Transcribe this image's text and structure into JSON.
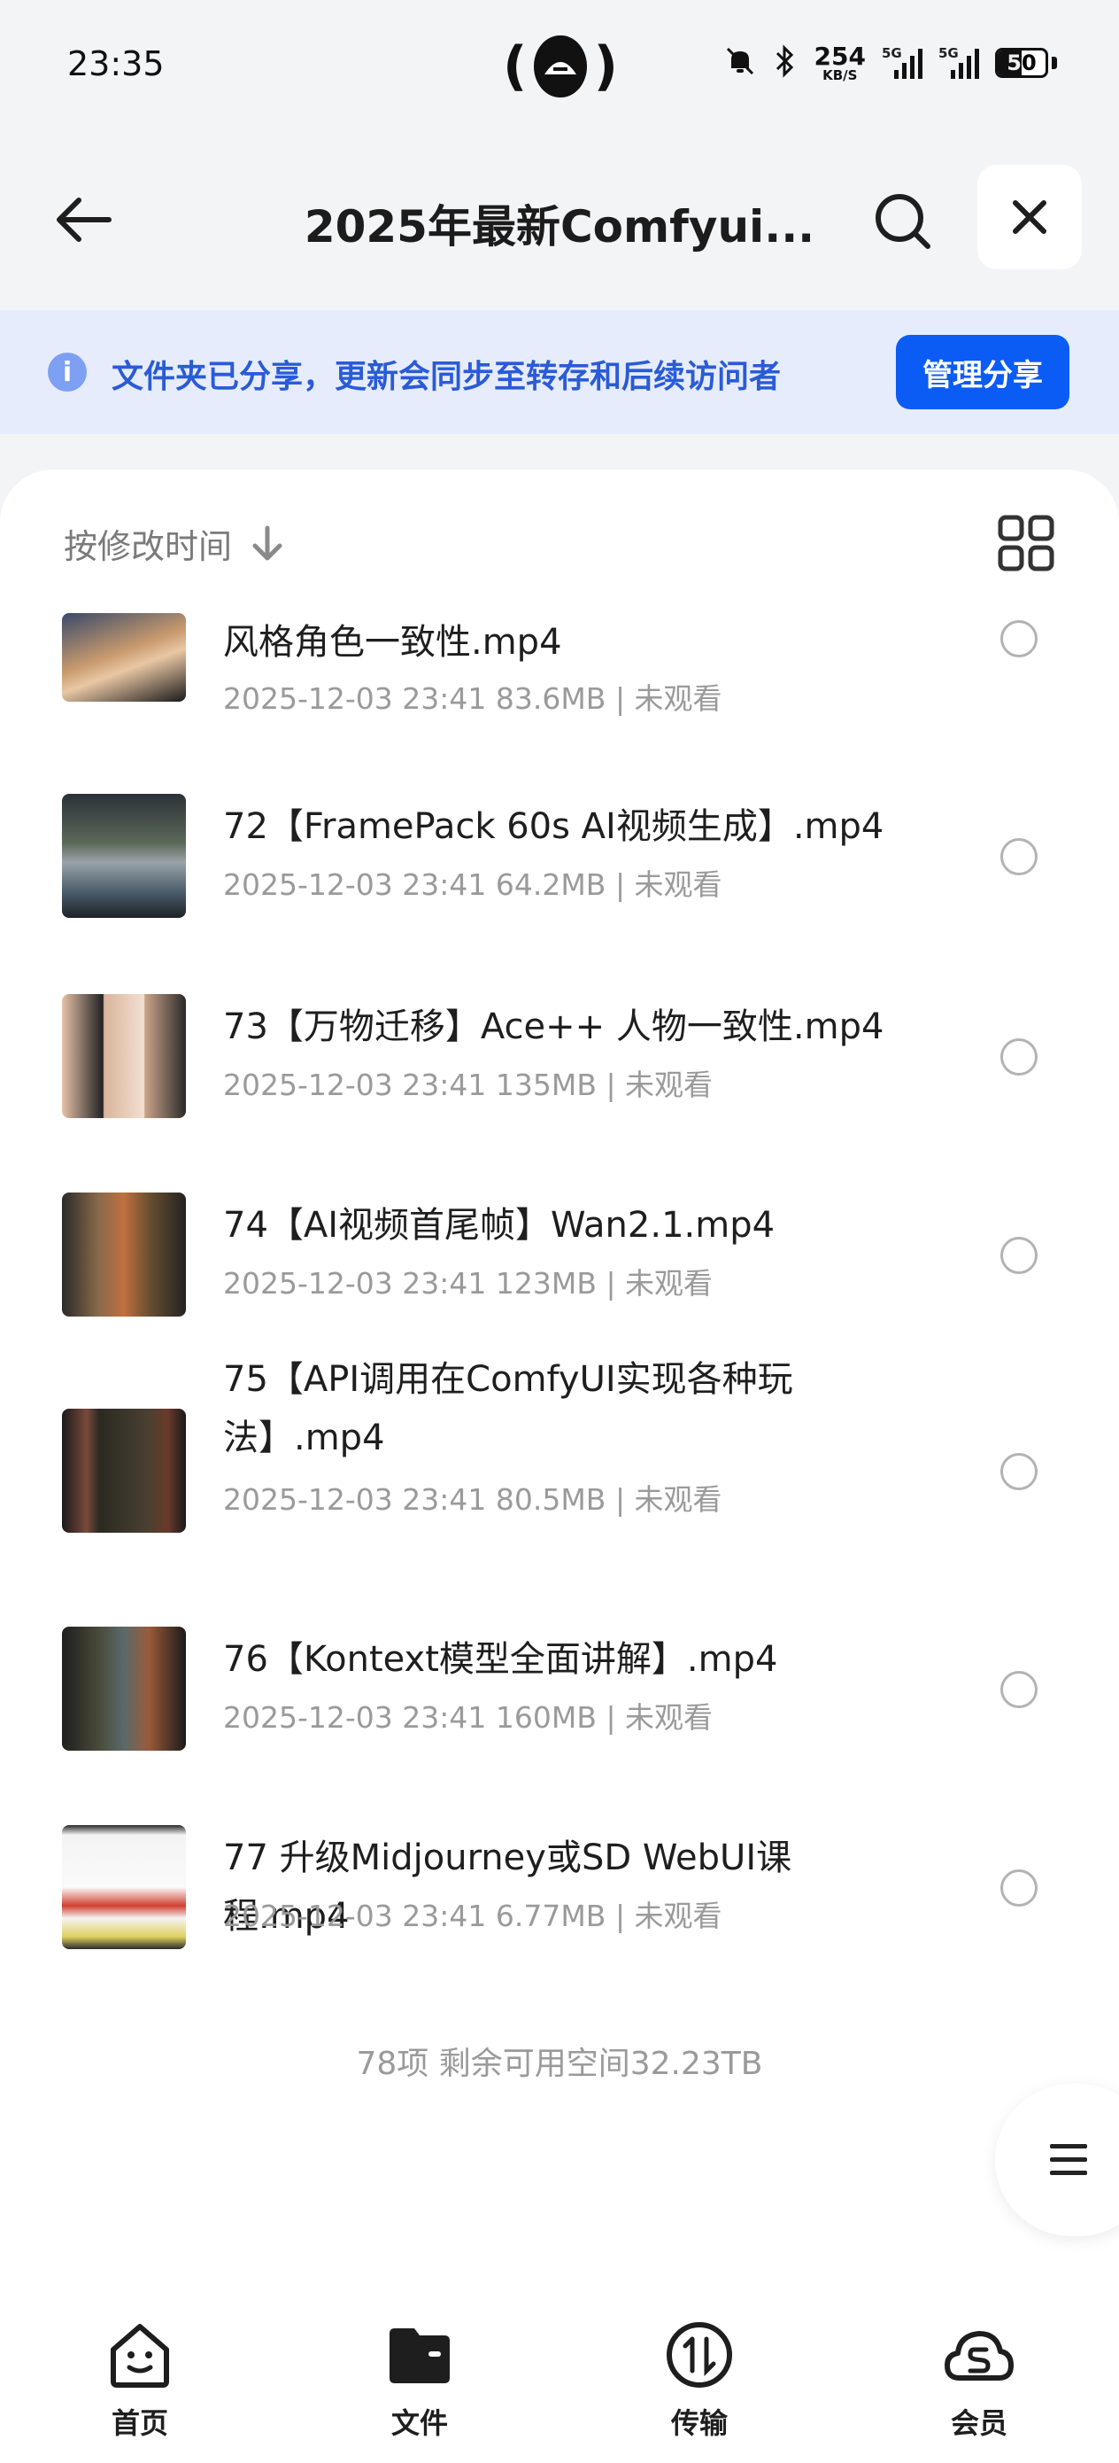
{
  "status_bar": {
    "time": "23:35",
    "net_speed_value": "254",
    "net_speed_unit": "KB/S",
    "sim1_tag": "5G",
    "sim2_tag": "5G",
    "battery_level": "50",
    "icons": [
      "hotspot-icon",
      "mute-icon",
      "bluetooth-icon",
      "signal-icon",
      "battery-icon"
    ]
  },
  "header": {
    "title": "2025年最新Comfyui...",
    "icons": [
      "back-arrow-icon",
      "search-icon",
      "close-icon"
    ]
  },
  "banner": {
    "text": "文件夹已分享，更新会同步至转存和后续访问者",
    "button_label": "管理分享",
    "icon": "info-icon",
    "accent": "#0a5cf5"
  },
  "sort": {
    "label": "按修改时间",
    "icon": "arrow-down-icon"
  },
  "files": [
    {
      "name": "风格角色一致性.mp4",
      "meta": "2025-12-03 23:41  83.6MB | 未观看"
    },
    {
      "name": "72【FramePack 60s AI视频生成】.mp4",
      "meta": "2025-12-03 23:41  64.2MB | 未观看"
    },
    {
      "name": "73【万物迁移】Ace++ 人物一致性.mp4",
      "meta": "2025-12-03 23:41  135MB | 未观看"
    },
    {
      "name": "74【AI视频首尾帧】Wan2.1.mp4",
      "meta": "2025-12-03 23:41  123MB | 未观看"
    },
    {
      "name": "75【API调用在ComfyUI实现各种玩法】.mp4",
      "meta": "2025-12-03 23:41  80.5MB | 未观看"
    },
    {
      "name": "76【Kontext模型全面讲解】.mp4",
      "meta": "2025-12-03 23:41  160MB | 未观看"
    },
    {
      "name": "77 升级Midjourney或SD WebUI课程.mp4",
      "meta": "2025-12-03 23:41  6.77MB | 未观看"
    }
  ],
  "summary": "78项 剩余可用空间32.23TB",
  "nav": [
    {
      "label": "首页",
      "icon": "smile-icon"
    },
    {
      "label": "文件",
      "icon": "folder-icon"
    },
    {
      "label": "传输",
      "icon": "transfer-icon"
    },
    {
      "label": "会员",
      "icon": "vip-cloud-icon"
    }
  ]
}
